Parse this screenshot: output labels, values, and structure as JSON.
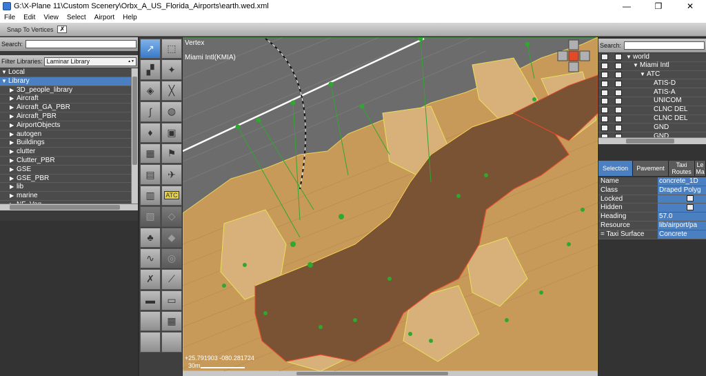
{
  "window": {
    "title": "G:\\X-Plane 11\\Custom Scenery\\Orbx_A_US_Florida_Airports\\earth.wed.xml",
    "minimize": "—",
    "maximize": "❐",
    "close": "✕"
  },
  "menu": [
    "File",
    "Edit",
    "View",
    "Select",
    "Airport",
    "Help"
  ],
  "toolbar": {
    "snap_label": "Snap To Vertices",
    "snap_checked": "✗"
  },
  "library": {
    "search_label": "Search:",
    "filter_label": "Filter Libraries:",
    "filter_value": "Laminar Library",
    "items": [
      {
        "label": "Local",
        "level": 0,
        "open": true
      },
      {
        "label": "Library",
        "level": 0,
        "open": true,
        "selected": true
      },
      {
        "label": "3D_people_library",
        "level": 1
      },
      {
        "label": "Aircraft",
        "level": 1
      },
      {
        "label": "Aircraft_GA_PBR",
        "level": 1
      },
      {
        "label": "Aircraft_PBR",
        "level": 1
      },
      {
        "label": "AirportObjects",
        "level": 1
      },
      {
        "label": "autogen",
        "level": 1
      },
      {
        "label": "Buildings",
        "level": 1
      },
      {
        "label": "clutter",
        "level": 1
      },
      {
        "label": "Clutter_PBR",
        "level": 1
      },
      {
        "label": "GSE",
        "level": 1
      },
      {
        "label": "GSE_PBR",
        "level": 1
      },
      {
        "label": "lib",
        "level": 1
      },
      {
        "label": "marine",
        "level": 1
      },
      {
        "label": "NF_Veg",
        "level": 1
      }
    ]
  },
  "tools": [
    {
      "name": "marquee-tool",
      "glyph": "↗",
      "state": "active"
    },
    {
      "name": "vertex-tool",
      "glyph": "⬚"
    },
    {
      "name": "runway-tool",
      "glyph": "▞"
    },
    {
      "name": "helipad-tool",
      "glyph": "✦"
    },
    {
      "name": "sealane-tool",
      "glyph": "◈"
    },
    {
      "name": "taxiway-tool",
      "glyph": "╳"
    },
    {
      "name": "taxiline-tool",
      "glyph": "∫"
    },
    {
      "name": "hole-tool",
      "glyph": "◍"
    },
    {
      "name": "light-tool",
      "glyph": "♦"
    },
    {
      "name": "sign-tool",
      "glyph": "▣"
    },
    {
      "name": "object-tool",
      "glyph": "▦"
    },
    {
      "name": "windsock-tool",
      "glyph": "⚑"
    },
    {
      "name": "boundary-tool",
      "glyph": "▤"
    },
    {
      "name": "ramp-start-tool",
      "glyph": "✈"
    },
    {
      "name": "facade-tool",
      "glyph": "▥"
    },
    {
      "name": "atc-tool",
      "glyph": "ATC"
    },
    {
      "name": "forest-tool",
      "glyph": "▧",
      "state": "dim"
    },
    {
      "name": "exclusion-tool",
      "glyph": "◇",
      "state": "dim"
    },
    {
      "name": "tree-tool",
      "glyph": "♣"
    },
    {
      "name": "polygon-tool",
      "glyph": "◆",
      "state": "dim"
    },
    {
      "name": "line-tool",
      "glyph": "∿"
    },
    {
      "name": "string-tool",
      "glyph": "◎",
      "state": "dim"
    },
    {
      "name": "delete-tool",
      "glyph": "✗"
    },
    {
      "name": "road-tool",
      "glyph": "⟋"
    },
    {
      "name": "truck-parking-tool",
      "glyph": "▬"
    },
    {
      "name": "truck-destination-tool",
      "glyph": "▭"
    },
    {
      "name": "empty-tool-a",
      "glyph": ""
    },
    {
      "name": "mixed-tool",
      "glyph": "▦"
    },
    {
      "name": "empty-tool-b",
      "glyph": ""
    },
    {
      "name": "empty-tool-c",
      "glyph": ""
    }
  ],
  "map": {
    "mode_label": "Vertex",
    "airport_label": "Miami Intl(KMIA)",
    "coords": "+25.791903 -080.281724",
    "scale": "30m"
  },
  "hierarchy": {
    "search_label": "Search:",
    "items": [
      {
        "label": "world",
        "indent": 0,
        "tri": "▼"
      },
      {
        "label": "Miami Intl",
        "indent": 1,
        "tri": "▼"
      },
      {
        "label": "ATC",
        "indent": 2,
        "tri": "▼"
      },
      {
        "label": "ATIS-D",
        "indent": 3,
        "tri": ""
      },
      {
        "label": "ATIS-A",
        "indent": 3,
        "tri": ""
      },
      {
        "label": "UNICOM",
        "indent": 3,
        "tri": ""
      },
      {
        "label": "CLNC DEL",
        "indent": 3,
        "tri": ""
      },
      {
        "label": "CLNC DEL",
        "indent": 3,
        "tri": ""
      },
      {
        "label": "GND",
        "indent": 3,
        "tri": ""
      },
      {
        "label": "GND",
        "indent": 3,
        "tri": ""
      }
    ]
  },
  "tabs": [
    "Selection",
    "Pavement",
    "Taxi Routes",
    "Le Ma"
  ],
  "properties": [
    {
      "key": "Name",
      "value": "concrete_1D"
    },
    {
      "key": "Class",
      "value": "Draped Polyg"
    },
    {
      "key": "Locked",
      "value": "",
      "icon": "lock-icon"
    },
    {
      "key": "Hidden",
      "value": "",
      "icon": "eye-icon"
    },
    {
      "key": "Heading",
      "value": "57.0"
    },
    {
      "key": "Resource",
      "value": "lib/airport/pa"
    },
    {
      "key": "= Taxi Surface",
      "value": "Concrete"
    }
  ],
  "colors": {
    "selection_blue": "#4a7fc1",
    "ground_tan": "#c79a5a",
    "taxiway_brown": "#7a5334",
    "node_green": "#2ea82e"
  }
}
